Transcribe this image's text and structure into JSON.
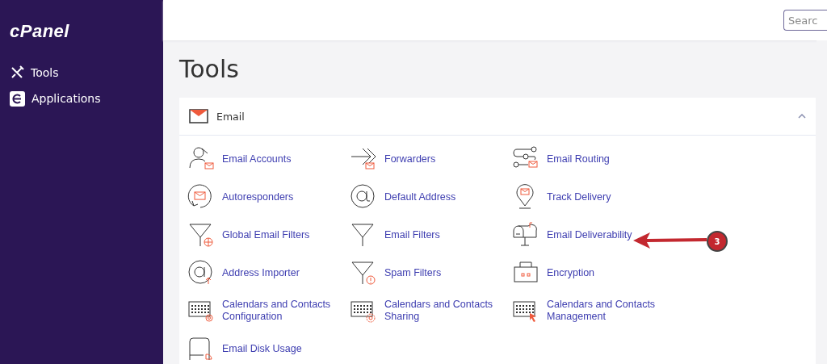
{
  "sidebar": {
    "logo": "cPanel",
    "items": [
      {
        "label": "Tools",
        "kind": "tools"
      },
      {
        "label": "Applications",
        "kind": "apps"
      }
    ]
  },
  "search": {
    "placeholder": "Searc"
  },
  "page_title": "Tools",
  "section": {
    "title": "Email",
    "expanded": true,
    "items": [
      {
        "label": "Email Accounts",
        "kind": "person"
      },
      {
        "label": "Forwarders",
        "kind": "arrows"
      },
      {
        "label": "Email Routing",
        "kind": "routing"
      },
      {
        "label": "Autoresponders",
        "kind": "cycle"
      },
      {
        "label": "Default Address",
        "kind": "at"
      },
      {
        "label": "Track Delivery",
        "kind": "pin"
      },
      {
        "label": "Global Email Filters",
        "kind": "funnelglobe"
      },
      {
        "label": "Email Filters",
        "kind": "funnel"
      },
      {
        "label": "Email Deliverability",
        "kind": "mailbox"
      },
      {
        "label": "Address Importer",
        "kind": "atupload"
      },
      {
        "label": "Spam Filters",
        "kind": "funnelwarning"
      },
      {
        "label": "Encryption",
        "kind": "case"
      },
      {
        "label": "Calendars and Contacts Configuration",
        "kind": "calat"
      },
      {
        "label": "Calendars and Contacts Sharing",
        "kind": "calgear"
      },
      {
        "label": "Calendars and Contacts Management",
        "kind": "calcursor"
      },
      {
        "label": "Email Disk Usage",
        "kind": "disk"
      }
    ]
  },
  "annotation": {
    "label": "3"
  }
}
